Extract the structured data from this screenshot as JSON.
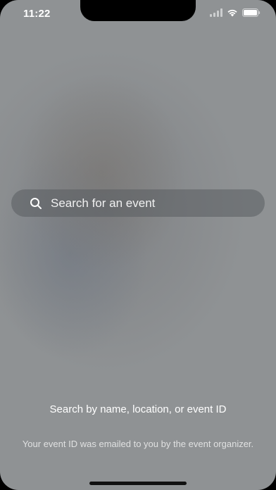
{
  "status_bar": {
    "time": "11:22",
    "icons": [
      "signal-icon",
      "wifi-icon",
      "battery-icon"
    ]
  },
  "search": {
    "placeholder": "Search for an event",
    "value": "",
    "icon": "search-icon"
  },
  "hint": {
    "title": "Search by name, location, or event ID",
    "subtitle": "Your event ID was emailed to you by the event organizer."
  },
  "colors": {
    "background": "#8f9294",
    "text": "#ffffff",
    "home_indicator": "#111111"
  }
}
